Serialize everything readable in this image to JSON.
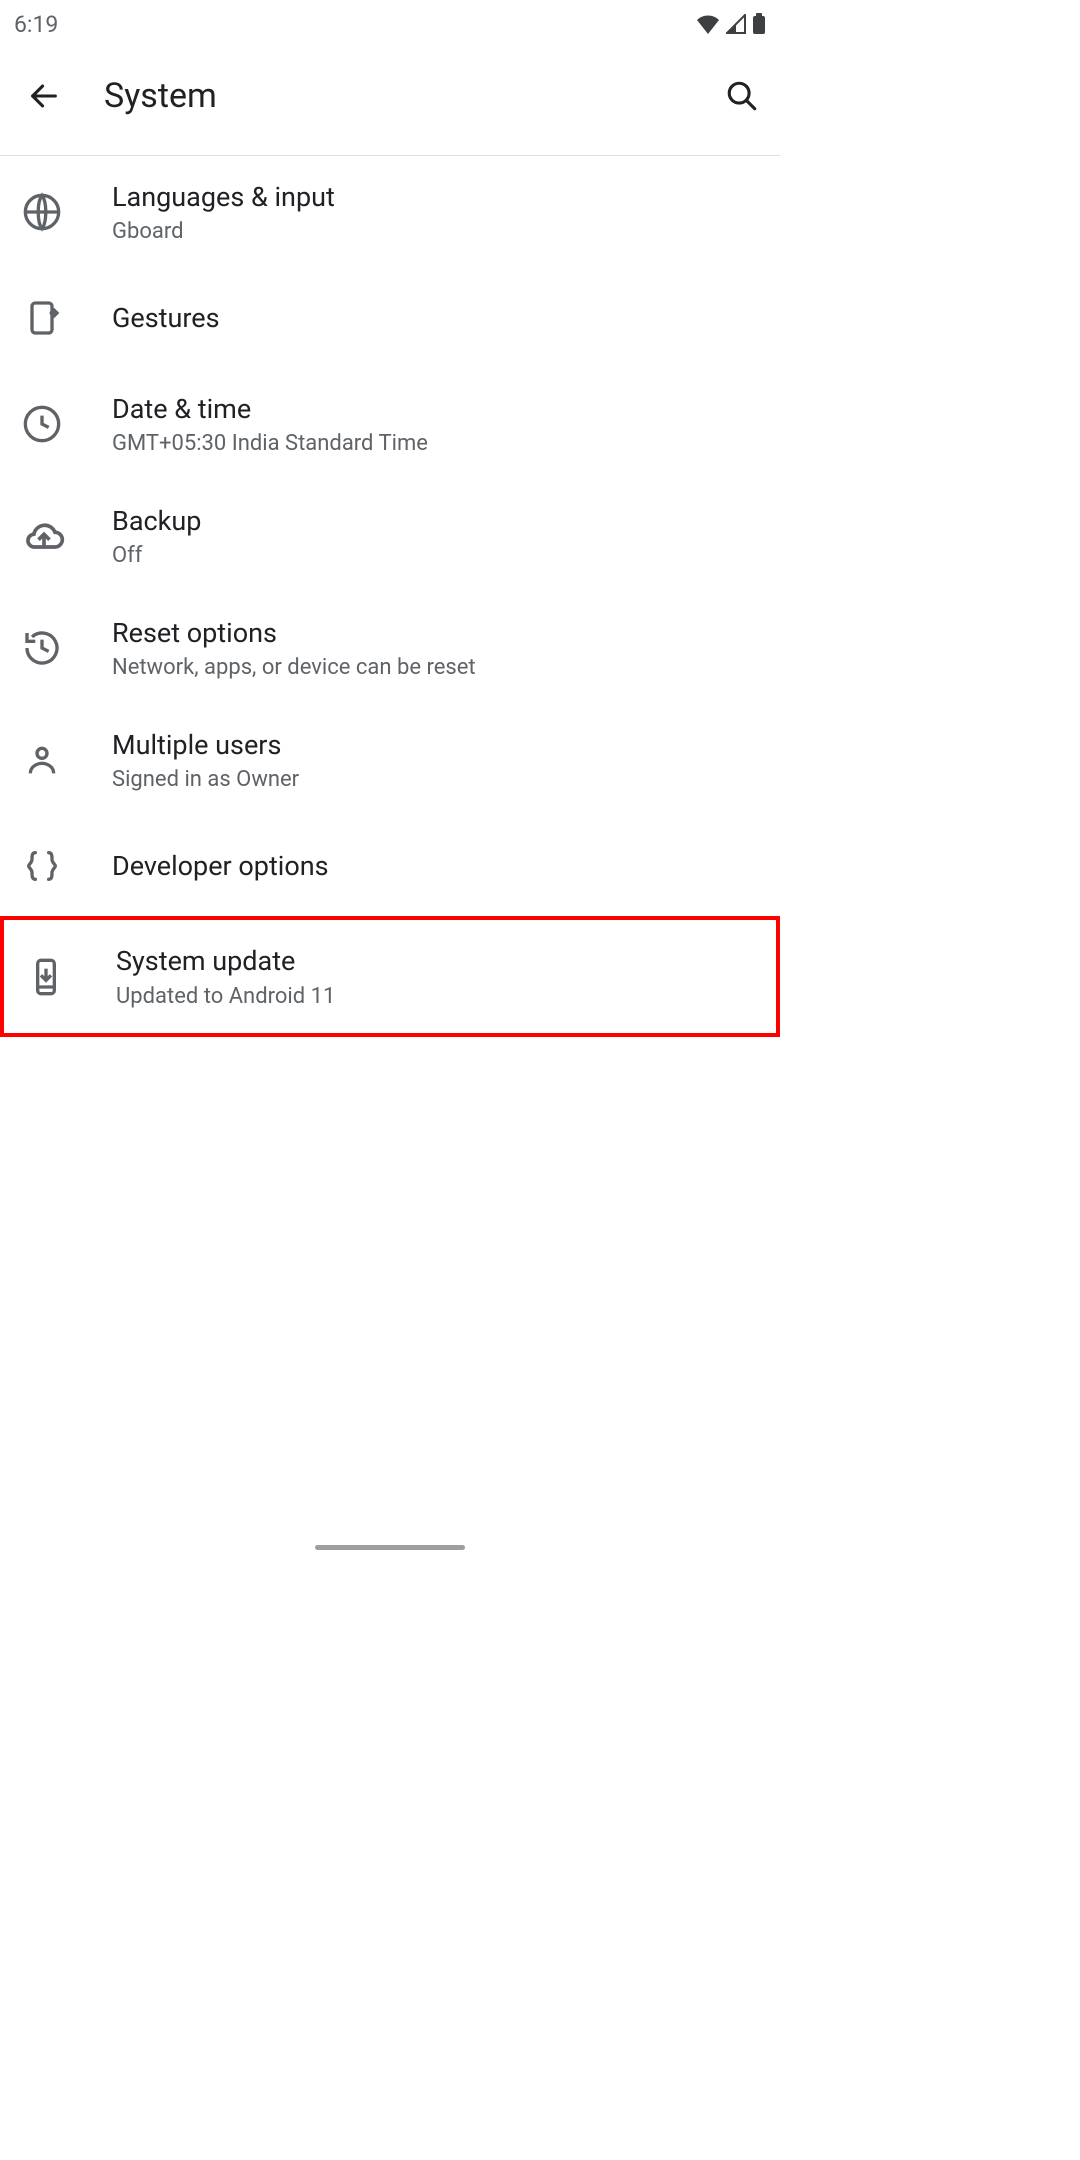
{
  "status": {
    "time": "6:19"
  },
  "header": {
    "title": "System"
  },
  "items": [
    {
      "title": "Languages & input",
      "sub": "Gboard"
    },
    {
      "title": "Gestures",
      "sub": ""
    },
    {
      "title": "Date & time",
      "sub": "GMT+05:30 India Standard Time"
    },
    {
      "title": "Backup",
      "sub": "Off"
    },
    {
      "title": "Reset options",
      "sub": "Network, apps, or device can be reset"
    },
    {
      "title": "Multiple users",
      "sub": "Signed in as Owner"
    },
    {
      "title": "Developer options",
      "sub": ""
    },
    {
      "title": "System update",
      "sub": "Updated to Android 11"
    }
  ]
}
